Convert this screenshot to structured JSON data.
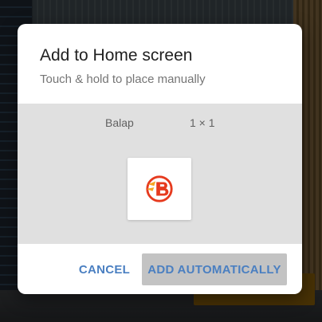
{
  "dialog": {
    "title": "Add to Home screen",
    "subtitle": "Touch & hold to place manually"
  },
  "widget": {
    "name": "Balap",
    "size": "1 × 1",
    "icon": "balap-logo-icon"
  },
  "actions": {
    "cancel_label": "CANCEL",
    "add_label": "ADD AUTOMATICALLY"
  },
  "colors": {
    "accent": "#4a7fc1",
    "logo_red": "#e63a1e",
    "logo_orange": "#f6a623"
  }
}
